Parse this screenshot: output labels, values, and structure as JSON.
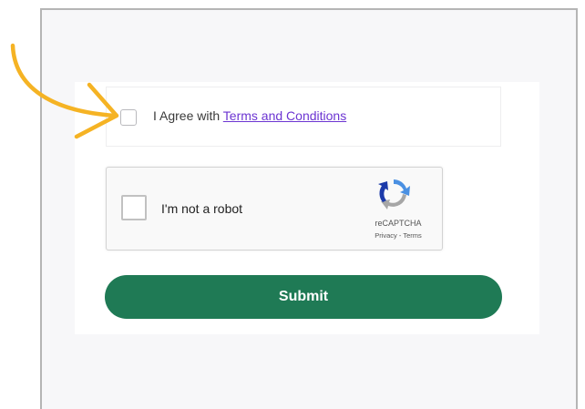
{
  "agreement": {
    "prefix": "I Agree with ",
    "link": "Terms and Conditions"
  },
  "recaptcha": {
    "label": "I'm not a robot",
    "brand": "reCAPTCHA",
    "links": "Privacy - Terms"
  },
  "submit": {
    "label": "Submit"
  },
  "colors": {
    "submit_bg": "#1f7a55",
    "link": "#6c35d2",
    "arrow": "#f5b324"
  },
  "icons": {
    "annotation": "curved-arrow-icon",
    "captcha": "recaptcha-logo-icon"
  }
}
